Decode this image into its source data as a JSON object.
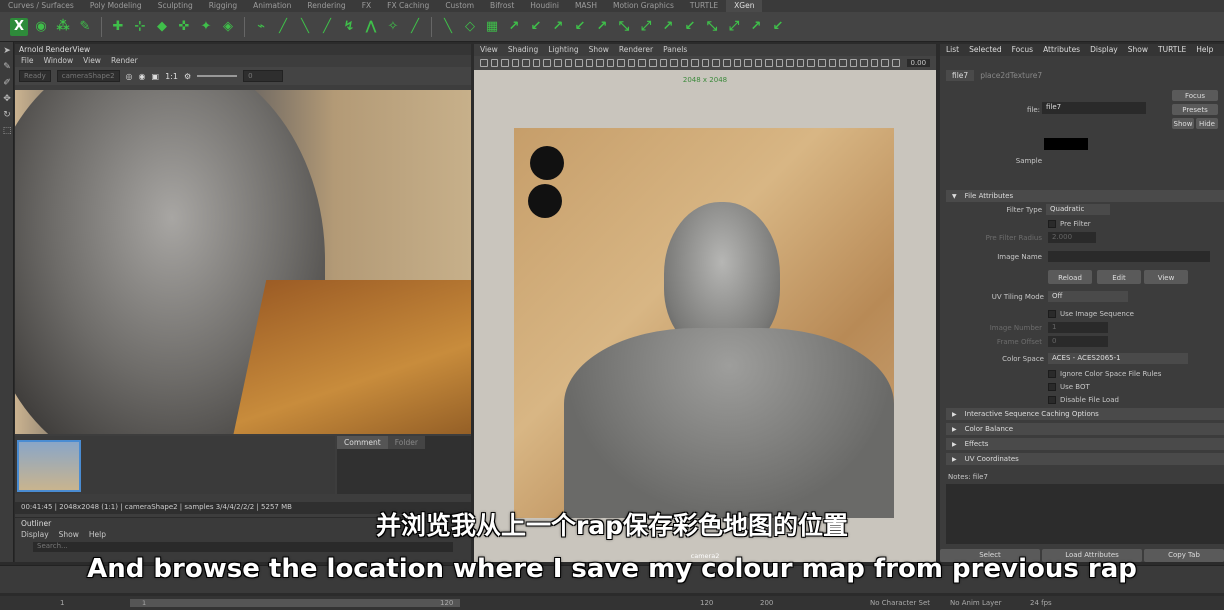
{
  "shelf_tabs": [
    "Curves / Surfaces",
    "Poly Modeling",
    "Sculpting",
    "Rigging",
    "Animation",
    "Rendering",
    "FX",
    "FX Caching",
    "Custom",
    "Bifrost",
    "Houdini",
    "MASH",
    "Motion Graphics",
    "TURTLE",
    "XGen"
  ],
  "shelf_active": "XGen",
  "render_view": {
    "title": "Arnold RenderView",
    "menu": [
      "File",
      "Window",
      "View",
      "Render"
    ],
    "status_dropdown": "Ready",
    "camera_dropdown": "cameraShape2",
    "ratio": "1:1",
    "exposure": "0",
    "panel_tabs": [
      "Comment",
      "Folder"
    ],
    "status_line": "00:41:45 | 2048x2048 (1:1) | cameraShape2 | samples 3/4/4/2/2/2 | 5257 MB"
  },
  "outliner": {
    "title": "Outliner",
    "menu": [
      "Display",
      "Show",
      "Help"
    ],
    "search_placeholder": "Search..."
  },
  "viewport": {
    "menu": [
      "View",
      "Shading",
      "Lighting",
      "Show",
      "Renderer",
      "Panels"
    ],
    "resolution": "2048 x 2048",
    "value": "0.00",
    "camera": "camera2"
  },
  "attribute_editor": {
    "menu": [
      "List",
      "Selected",
      "Focus",
      "Attributes",
      "Display",
      "Show",
      "TURTLE",
      "Help"
    ],
    "tabs": [
      "file7",
      "place2dTexture7"
    ],
    "file_label": "file:",
    "file_value": "file7",
    "focus": "Focus",
    "presets": "Presets",
    "show": "Show",
    "hide": "Hide",
    "sample_label": "Sample",
    "section_file_attributes": "File Attributes",
    "filter_type_label": "Filter Type",
    "filter_type_value": "Quadratic",
    "pre_filter": "Pre Filter",
    "pre_filter_radius_label": "Pre Filter Radius",
    "pre_filter_radius_value": "2.000",
    "image_name_label": "Image Name",
    "reload": "Reload",
    "edit": "Edit",
    "view": "View",
    "uv_tiling_label": "UV Tiling Mode",
    "uv_tiling_value": "Off",
    "use_image_sequence": "Use Image Sequence",
    "image_number_label": "Image Number",
    "image_number_value": "1",
    "frame_offset_label": "Frame Offset",
    "frame_offset_value": "0",
    "color_space_label": "Color Space",
    "color_space_value": "ACES - ACES2065-1",
    "ignore_cs": "Ignore Color Space File Rules",
    "use_bot": "Use BOT",
    "disable_file_load": "Disable File Load",
    "sections": [
      "Interactive Sequence Caching Options",
      "Color Balance",
      "Effects",
      "UV Coordinates"
    ],
    "notes": "Notes: file7",
    "bottom_buttons": [
      "Select",
      "Load Attributes",
      "Copy Tab"
    ]
  },
  "timeline": {
    "start": "1",
    "start2": "1",
    "range_end": "120",
    "end": "120",
    "end2": "200",
    "character_set": "No Character Set",
    "anim_layer": "No Anim Layer",
    "fps": "24 fps"
  },
  "subtitles": {
    "cn": "并浏览我从上一个rap保存彩色地图的位置",
    "en": "And browse the location where I save my colour map from previous rap"
  },
  "colors": {
    "accent": "#4a8cd2",
    "shelf_icon": "#3fbf4a"
  }
}
